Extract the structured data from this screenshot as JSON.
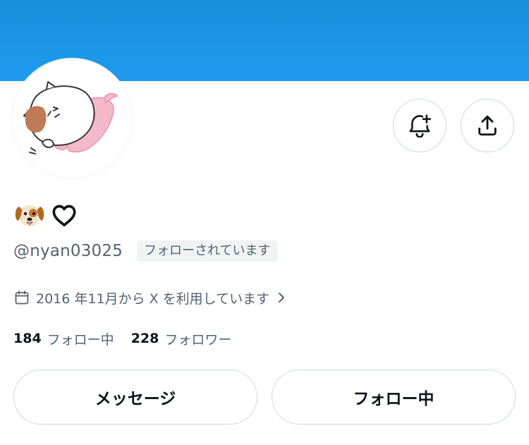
{
  "profile": {
    "display_name_emojis": [
      "dog-face-emoji",
      "white-heart-emoji"
    ],
    "handle": "@nyan03025",
    "follows_you_badge": "フォローされています",
    "joined_text": "2016 年11月から X を利用しています",
    "stats": {
      "following_count": "184",
      "following_label": "フォロー中",
      "followers_count": "228",
      "followers_label": "フォロワー"
    }
  },
  "actions": {
    "message_label": "メッセージ",
    "following_label": "フォロー中"
  },
  "icons": {
    "notify": "bell-plus-icon",
    "share": "share-upload-icon",
    "calendar": "calendar-icon",
    "chevron": "chevron-right-icon"
  },
  "colors": {
    "banner": "#1d9bf0",
    "text_primary": "#0f1419",
    "text_secondary": "#536471",
    "border": "#cfd9de",
    "badge_bg": "#eff3f4"
  }
}
